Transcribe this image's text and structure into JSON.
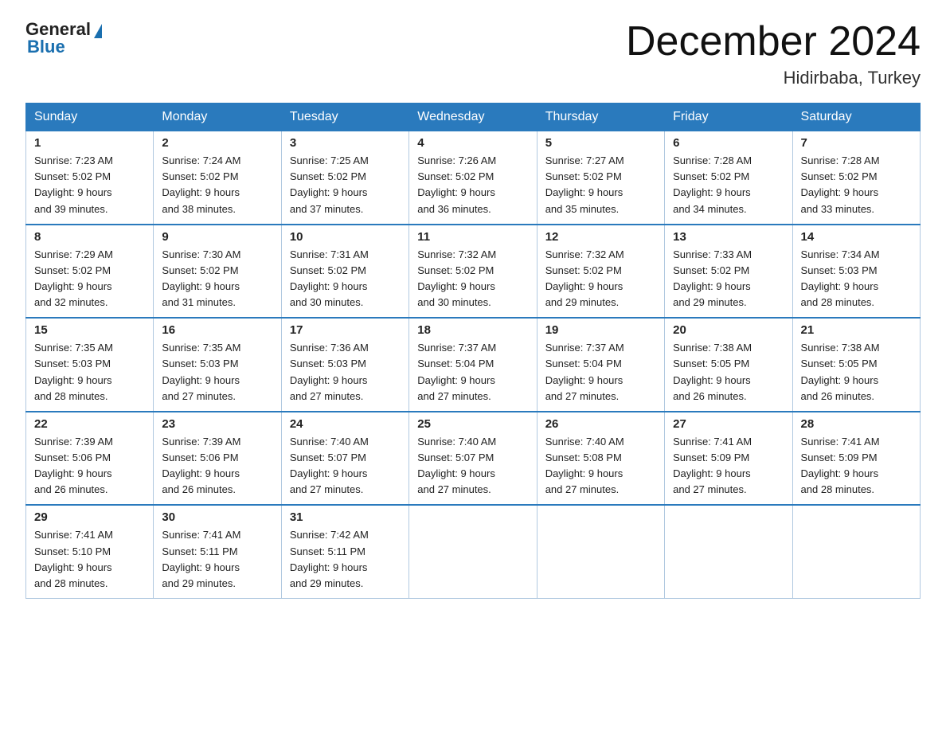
{
  "header": {
    "logo_general": "General",
    "logo_blue": "Blue",
    "month_title": "December 2024",
    "subtitle": "Hidirbaba, Turkey"
  },
  "days_of_week": [
    "Sunday",
    "Monday",
    "Tuesday",
    "Wednesday",
    "Thursday",
    "Friday",
    "Saturday"
  ],
  "weeks": [
    [
      {
        "day": 1,
        "sunrise": "7:23 AM",
        "sunset": "5:02 PM",
        "daylight": "9 hours and 39 minutes."
      },
      {
        "day": 2,
        "sunrise": "7:24 AM",
        "sunset": "5:02 PM",
        "daylight": "9 hours and 38 minutes."
      },
      {
        "day": 3,
        "sunrise": "7:25 AM",
        "sunset": "5:02 PM",
        "daylight": "9 hours and 37 minutes."
      },
      {
        "day": 4,
        "sunrise": "7:26 AM",
        "sunset": "5:02 PM",
        "daylight": "9 hours and 36 minutes."
      },
      {
        "day": 5,
        "sunrise": "7:27 AM",
        "sunset": "5:02 PM",
        "daylight": "9 hours and 35 minutes."
      },
      {
        "day": 6,
        "sunrise": "7:28 AM",
        "sunset": "5:02 PM",
        "daylight": "9 hours and 34 minutes."
      },
      {
        "day": 7,
        "sunrise": "7:28 AM",
        "sunset": "5:02 PM",
        "daylight": "9 hours and 33 minutes."
      }
    ],
    [
      {
        "day": 8,
        "sunrise": "7:29 AM",
        "sunset": "5:02 PM",
        "daylight": "9 hours and 32 minutes."
      },
      {
        "day": 9,
        "sunrise": "7:30 AM",
        "sunset": "5:02 PM",
        "daylight": "9 hours and 31 minutes."
      },
      {
        "day": 10,
        "sunrise": "7:31 AM",
        "sunset": "5:02 PM",
        "daylight": "9 hours and 30 minutes."
      },
      {
        "day": 11,
        "sunrise": "7:32 AM",
        "sunset": "5:02 PM",
        "daylight": "9 hours and 30 minutes."
      },
      {
        "day": 12,
        "sunrise": "7:32 AM",
        "sunset": "5:02 PM",
        "daylight": "9 hours and 29 minutes."
      },
      {
        "day": 13,
        "sunrise": "7:33 AM",
        "sunset": "5:02 PM",
        "daylight": "9 hours and 29 minutes."
      },
      {
        "day": 14,
        "sunrise": "7:34 AM",
        "sunset": "5:03 PM",
        "daylight": "9 hours and 28 minutes."
      }
    ],
    [
      {
        "day": 15,
        "sunrise": "7:35 AM",
        "sunset": "5:03 PM",
        "daylight": "9 hours and 28 minutes."
      },
      {
        "day": 16,
        "sunrise": "7:35 AM",
        "sunset": "5:03 PM",
        "daylight": "9 hours and 27 minutes."
      },
      {
        "day": 17,
        "sunrise": "7:36 AM",
        "sunset": "5:03 PM",
        "daylight": "9 hours and 27 minutes."
      },
      {
        "day": 18,
        "sunrise": "7:37 AM",
        "sunset": "5:04 PM",
        "daylight": "9 hours and 27 minutes."
      },
      {
        "day": 19,
        "sunrise": "7:37 AM",
        "sunset": "5:04 PM",
        "daylight": "9 hours and 27 minutes."
      },
      {
        "day": 20,
        "sunrise": "7:38 AM",
        "sunset": "5:05 PM",
        "daylight": "9 hours and 26 minutes."
      },
      {
        "day": 21,
        "sunrise": "7:38 AM",
        "sunset": "5:05 PM",
        "daylight": "9 hours and 26 minutes."
      }
    ],
    [
      {
        "day": 22,
        "sunrise": "7:39 AM",
        "sunset": "5:06 PM",
        "daylight": "9 hours and 26 minutes."
      },
      {
        "day": 23,
        "sunrise": "7:39 AM",
        "sunset": "5:06 PM",
        "daylight": "9 hours and 26 minutes."
      },
      {
        "day": 24,
        "sunrise": "7:40 AM",
        "sunset": "5:07 PM",
        "daylight": "9 hours and 27 minutes."
      },
      {
        "day": 25,
        "sunrise": "7:40 AM",
        "sunset": "5:07 PM",
        "daylight": "9 hours and 27 minutes."
      },
      {
        "day": 26,
        "sunrise": "7:40 AM",
        "sunset": "5:08 PM",
        "daylight": "9 hours and 27 minutes."
      },
      {
        "day": 27,
        "sunrise": "7:41 AM",
        "sunset": "5:09 PM",
        "daylight": "9 hours and 27 minutes."
      },
      {
        "day": 28,
        "sunrise": "7:41 AM",
        "sunset": "5:09 PM",
        "daylight": "9 hours and 28 minutes."
      }
    ],
    [
      {
        "day": 29,
        "sunrise": "7:41 AM",
        "sunset": "5:10 PM",
        "daylight": "9 hours and 28 minutes."
      },
      {
        "day": 30,
        "sunrise": "7:41 AM",
        "sunset": "5:11 PM",
        "daylight": "9 hours and 29 minutes."
      },
      {
        "day": 31,
        "sunrise": "7:42 AM",
        "sunset": "5:11 PM",
        "daylight": "9 hours and 29 minutes."
      },
      null,
      null,
      null,
      null
    ]
  ],
  "labels": {
    "sunrise": "Sunrise:",
    "sunset": "Sunset:",
    "daylight": "Daylight:"
  }
}
